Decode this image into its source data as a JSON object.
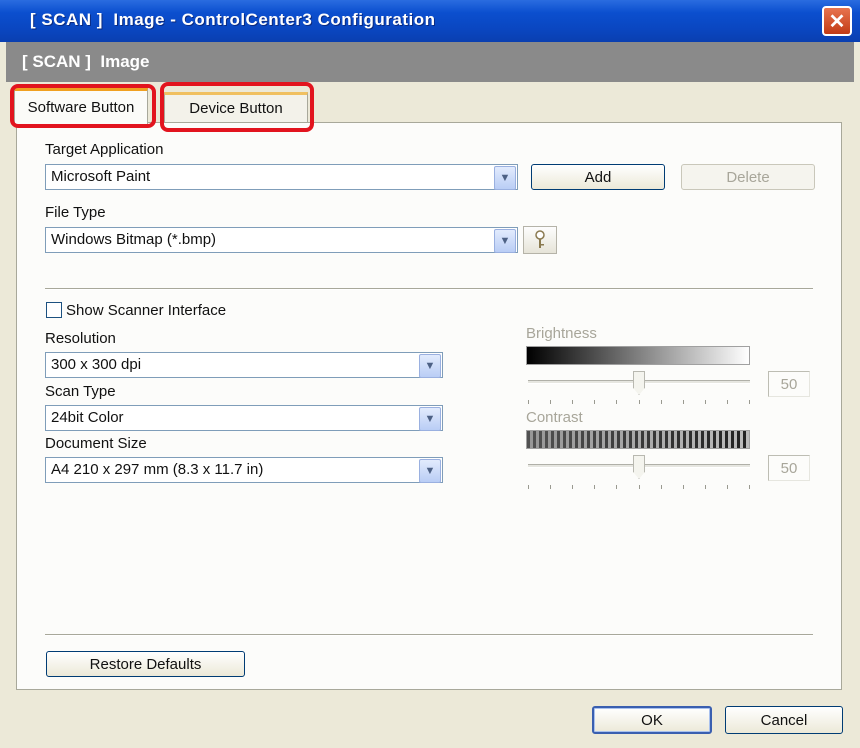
{
  "window": {
    "title": "[ SCAN ]  Image - ControlCenter3 Configuration",
    "close_symbol": "✕"
  },
  "header": {
    "text": "[ SCAN ]  Image"
  },
  "tabs": [
    {
      "label": "Software Button",
      "active": true
    },
    {
      "label": "Device Button",
      "active": false
    }
  ],
  "target_application": {
    "label": "Target Application",
    "value": "Microsoft Paint",
    "add_label": "Add",
    "delete_label": "Delete"
  },
  "file_type": {
    "label": "File Type",
    "value": "Windows Bitmap (*.bmp)"
  },
  "show_scanner_interface": {
    "label": "Show Scanner Interface",
    "checked": false
  },
  "resolution": {
    "label": "Resolution",
    "value": "300 x 300 dpi"
  },
  "scan_type": {
    "label": "Scan Type",
    "value": "24bit Color"
  },
  "document_size": {
    "label": "Document Size",
    "value": "A4 210 x 297 mm (8.3 x 11.7 in)"
  },
  "brightness": {
    "label": "Brightness",
    "value": "50",
    "level": 0.5
  },
  "contrast": {
    "label": "Contrast",
    "value": "50",
    "level": 0.5
  },
  "restore_defaults_label": "Restore Defaults",
  "ok_label": "OK",
  "cancel_label": "Cancel",
  "dropdown_arrow": "▼",
  "colors": {
    "highlight": "#e2141e",
    "titlebar": "#0b4fcf",
    "dialog_bg": "#ece9d8"
  },
  "icons": {
    "close": "close-icon",
    "dropdown": "chevron-down-icon",
    "file_type_options": "key-icon"
  }
}
